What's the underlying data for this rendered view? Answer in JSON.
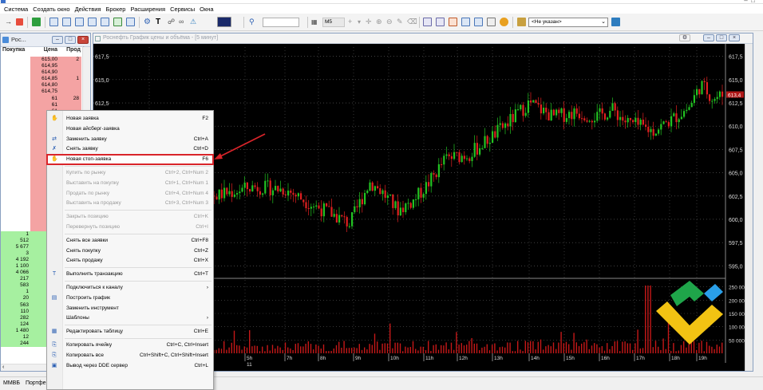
{
  "menubar": [
    "Система",
    "Создать окно",
    "Действия",
    "Брокер",
    "Расширения",
    "Сервисы",
    "Окна"
  ],
  "toolbar": {
    "timeframe": "M5",
    "instrument_select": "<Не указан>"
  },
  "orderbook": {
    "title": "Рос...",
    "col_buy": "Покупка",
    "col_price": "Цена",
    "col_sell": "Прод",
    "asks": [
      {
        "price": "615,00",
        "sell": "2"
      },
      {
        "price": "614,95",
        "sell": ""
      },
      {
        "price": "614,90",
        "sell": ""
      },
      {
        "price": "614,85",
        "sell": "1"
      },
      {
        "price": "614,80",
        "sell": ""
      },
      {
        "price": "614,75",
        "sell": ""
      },
      {
        "price": "61",
        "sell": "28"
      },
      {
        "price": "61",
        "sell": ""
      },
      {
        "price": "61",
        "sell": ""
      },
      {
        "price": "61",
        "sell": ""
      },
      {
        "price": "61",
        "sell": ""
      },
      {
        "price": "61",
        "sell": ""
      },
      {
        "price": "61",
        "sell": ""
      },
      {
        "price": "61",
        "sell": ""
      },
      {
        "price": "61",
        "sell": ""
      },
      {
        "price": "61",
        "sell": ""
      },
      {
        "price": "61",
        "sell": ""
      },
      {
        "price": "61",
        "sell": ""
      },
      {
        "price": "61",
        "sell": ""
      },
      {
        "price": "61",
        "sell": ""
      },
      {
        "price": "61",
        "sell": ""
      },
      {
        "price": "61",
        "sell": ""
      },
      {
        "price": "61",
        "sell": ""
      },
      {
        "price": "61",
        "sell": ""
      },
      {
        "price": "61",
        "sell": ""
      },
      {
        "price": "61",
        "sell": ""
      },
      {
        "price": "61",
        "sell": ""
      }
    ],
    "bids": [
      {
        "buy": "1",
        "price": "61"
      },
      {
        "buy": "512",
        "price": "61"
      },
      {
        "buy": "5 677",
        "price": "61"
      },
      {
        "buy": "3",
        "price": "61"
      },
      {
        "buy": "4 192",
        "price": "61"
      },
      {
        "buy": "1 100",
        "price": "61"
      },
      {
        "buy": "4 066",
        "price": "61"
      },
      {
        "buy": "217",
        "price": "61"
      },
      {
        "buy": "583",
        "price": "61"
      },
      {
        "buy": "1",
        "price": "61"
      },
      {
        "buy": "20",
        "price": "61"
      },
      {
        "buy": "563",
        "price": "61"
      },
      {
        "buy": "110",
        "price": "61"
      },
      {
        "buy": "282",
        "price": "61"
      },
      {
        "buy": "124",
        "price": "61"
      },
      {
        "buy": "1 480",
        "price": "61"
      },
      {
        "buy": "12",
        "price": "61"
      },
      {
        "buy": "244",
        "price": "61"
      }
    ]
  },
  "chart_window": {
    "title": "Роснефть График цены и объёма - [5 минут]"
  },
  "chart_data": {
    "type": "candlestick",
    "price_axis": {
      "ticks": [
        "617,5",
        "615,0",
        "612,5",
        "610,0",
        "607,5",
        "605,0",
        "602,5",
        "600,0",
        "597,5",
        "595,0"
      ],
      "range": [
        594,
        618.5
      ]
    },
    "volume_axis": {
      "ticks": [
        "250 000",
        "200 000",
        "150 000",
        "100 000",
        "50 000"
      ],
      "range": [
        0,
        270000
      ]
    },
    "time_ticks": [
      "22h",
      "5h",
      "7h",
      "8h",
      "9h",
      "10h",
      "11h",
      "12h",
      "13h",
      "14h",
      "15h",
      "16h",
      "17h",
      "18h",
      "19h"
    ],
    "sub_date": "11",
    "last_price_tag": "613,4",
    "grid": true,
    "background": "#000000",
    "up_color": "#22c322",
    "down_color": "#e02020"
  },
  "context_menu": {
    "items": [
      {
        "label": "Новая заявка",
        "shortcut": "F2",
        "icon": "order-icon",
        "disabled": false
      },
      {
        "label": "Новая айсберг-заявка",
        "shortcut": "",
        "icon": "",
        "disabled": false
      },
      {
        "label": "Заменить заявку",
        "shortcut": "Ctrl+A",
        "icon": "replace-icon",
        "disabled": false
      },
      {
        "label": "Снять заявку",
        "shortcut": "Ctrl+D",
        "icon": "cancel-order-icon",
        "disabled": false
      },
      {
        "label": "Новая стоп-заявка",
        "shortcut": "F6",
        "icon": "stop-order-icon",
        "disabled": false,
        "highlighted": true
      },
      {
        "label": "Купить по рынку",
        "shortcut": "Ctrl+2, Ctrl+Num 2",
        "icon": "",
        "disabled": true
      },
      {
        "label": "Выставить на покупку",
        "shortcut": "Ctrl+1, Ctrl+Num 1",
        "icon": "",
        "disabled": true
      },
      {
        "label": "Продать по рынку",
        "shortcut": "Ctrl+4, Ctrl+Num 4",
        "icon": "",
        "disabled": true
      },
      {
        "label": "Выставить на продажу",
        "shortcut": "Ctrl+3, Ctrl+Num 3",
        "icon": "",
        "disabled": true
      },
      {
        "label": "Закрыть позицию",
        "shortcut": "Ctrl+K",
        "icon": "",
        "disabled": true
      },
      {
        "label": "Перевернуть позицию",
        "shortcut": "Ctrl+I",
        "icon": "",
        "disabled": true
      },
      {
        "label": "Снять все заявки",
        "shortcut": "Ctrl+F8",
        "icon": "",
        "disabled": false
      },
      {
        "label": "Снять покупку",
        "shortcut": "Ctrl+Z",
        "icon": "",
        "disabled": false
      },
      {
        "label": "Снять продажу",
        "shortcut": "Ctrl+X",
        "icon": "",
        "disabled": false
      },
      {
        "label": "Выполнить транзакцию",
        "shortcut": "Ctrl+T",
        "icon": "transaction-icon",
        "disabled": false
      },
      {
        "label": "Подключиться к каналу",
        "shortcut": "›",
        "icon": "",
        "disabled": false
      },
      {
        "label": "Построить график",
        "shortcut": "",
        "icon": "chart-icon",
        "disabled": false
      },
      {
        "label": "Заменить инструмент",
        "shortcut": "",
        "icon": "",
        "disabled": false
      },
      {
        "label": "Шаблоны",
        "shortcut": "›",
        "icon": "",
        "disabled": false
      },
      {
        "label": "Редактировать таблицу",
        "shortcut": "Ctrl+E",
        "icon": "edit-table-icon",
        "disabled": false
      },
      {
        "label": "Копировать ячейку",
        "shortcut": "Ctrl+C, Ctrl+Insert",
        "icon": "copy-cell-icon",
        "disabled": false
      },
      {
        "label": "Копировать все",
        "shortcut": "Ctrl+Shift+C, Ctrl+Shift+Insert",
        "icon": "copy-all-icon",
        "disabled": false
      },
      {
        "label": "Вывод через DDE сервер",
        "shortcut": "Ctrl+L",
        "icon": "dde-icon",
        "disabled": false
      }
    ]
  },
  "statusbar": {
    "left": "ММВБ",
    "tab": "Портфе"
  },
  "colors": {
    "annotation_arrow": "#d9242a",
    "ask_bg": "#f4a3a3",
    "bid_bg": "#a6f0a0"
  }
}
